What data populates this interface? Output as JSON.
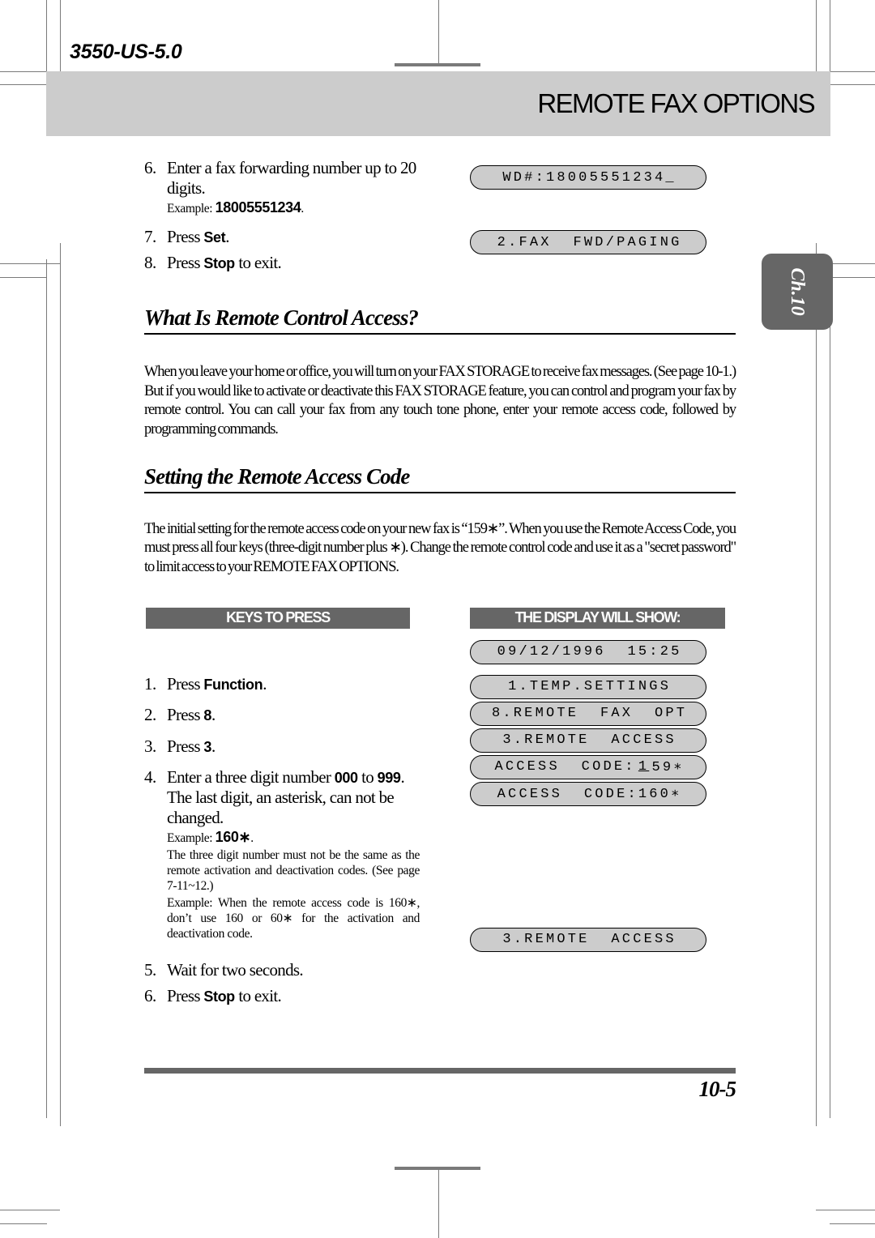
{
  "header": {
    "doc_code": "3550-US-5.0",
    "chapter_title": "REMOTE FAX OPTIONS",
    "chapter_tab": "Ch.10"
  },
  "top_steps": [
    {
      "num": "6.",
      "text_a": "Enter a fax forwarding number up to 20 digits.",
      "note_label": "Example: ",
      "note_bold": "18005551234",
      "note_tail": "."
    },
    {
      "num": "7.",
      "pre": "Press ",
      "key": "Set",
      "post": "."
    },
    {
      "num": "8.",
      "pre": "Press ",
      "key": "Stop",
      "post": " to exit."
    }
  ],
  "top_displays": [
    {
      "text": "WD#:18005551234_"
    },
    {
      "text": "2.FAX  FWD/PAGING"
    }
  ],
  "sections": [
    {
      "heading": "What Is Remote Control Access?",
      "paragraph": "When you leave your home or office, you will turn on your FAX STORAGE to receive fax messages. (See page 10-1.) But if you would like to activate or deactivate this FAX STORAGE feature, you can control and program your fax by remote control. You can call your fax from any touch tone phone, enter your remote access code, followed by programming commands."
    },
    {
      "heading": "Setting the Remote Access Code",
      "paragraph": "The initial setting for the remote access code on your new fax is “159∗”. When you use the Remote Access Code, you must press all four keys (three-digit number plus ∗). Change the remote control code and use it as a \"secret password\" to limit access to your REMOTE FAX OPTIONS."
    }
  ],
  "table": {
    "header_keys": "KEYS TO PRESS",
    "header_display": "THE DISPLAY WILL SHOW:",
    "steps": [
      {
        "num": "1.",
        "pre": "Press ",
        "key": "Function",
        "post": "."
      },
      {
        "num": "2.",
        "pre": "Press ",
        "key": "8",
        "post": "."
      },
      {
        "num": "3.",
        "pre": "Press ",
        "key": "3",
        "post": "."
      },
      {
        "num": "4.",
        "frag1": "Enter a three digit number ",
        "key1": "000",
        "frag2": " to ",
        "key2": "999",
        "frag3": ". The last digit, an asterisk, can not be changed.",
        "note_label": "Example: ",
        "note_bold": "160∗",
        "note_tail": ".",
        "note_body": "The three digit number must not be the same as the remote activation and deactivation codes. (See page 7-11~12.)",
        "note_body2": "Example: When the remote access code is 160∗, don’t use 160 or 60∗ for the activation and deactivation code."
      },
      {
        "num": "5.",
        "pre": "Wait for two seconds.",
        "key": "",
        "post": ""
      },
      {
        "num": "6.",
        "pre": "Press ",
        "key": "Stop",
        "post": " to exit."
      }
    ],
    "displays": [
      {
        "text": "09/12/1996  15:25"
      },
      {
        "text": "1.TEMP.SETTINGS"
      },
      {
        "text": "8.REMOTE  FAX  OPT"
      },
      {
        "text": "3.REMOTE  ACCESS"
      },
      {
        "pre": "ACCESS  CODE:",
        "cursor": "1",
        "post": "59∗"
      },
      {
        "text": "ACCESS  CODE:160∗"
      },
      {
        "text": "3.REMOTE  ACCESS"
      }
    ]
  },
  "footer": {
    "page_number": "10-5"
  }
}
